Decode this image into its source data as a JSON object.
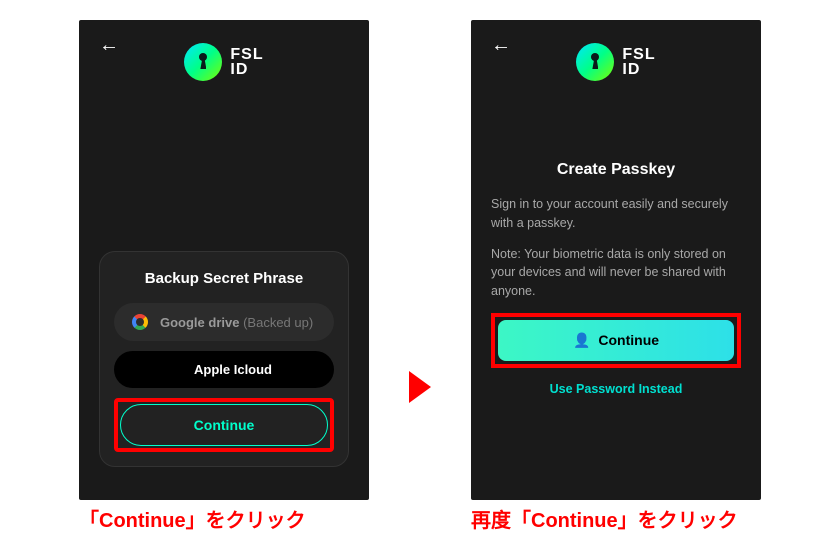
{
  "brand": {
    "line1": "FSL",
    "line2": "ID"
  },
  "left": {
    "card_title": "Backup Secret Phrase",
    "google_label": "Google drive",
    "google_status": "(Backed up)",
    "apple_label": "Apple Icloud",
    "continue_label": "Continue",
    "caption": "「Continue」をクリック"
  },
  "right": {
    "title": "Create Passkey",
    "p1": "Sign in to your account easily and securely with a passkey.",
    "p2": "Note: Your biometric data is only stored on your devices and will never be shared with anyone.",
    "continue_label": "Continue",
    "alt_link": "Use Password Instead",
    "caption": "再度「Continue」をクリック"
  }
}
